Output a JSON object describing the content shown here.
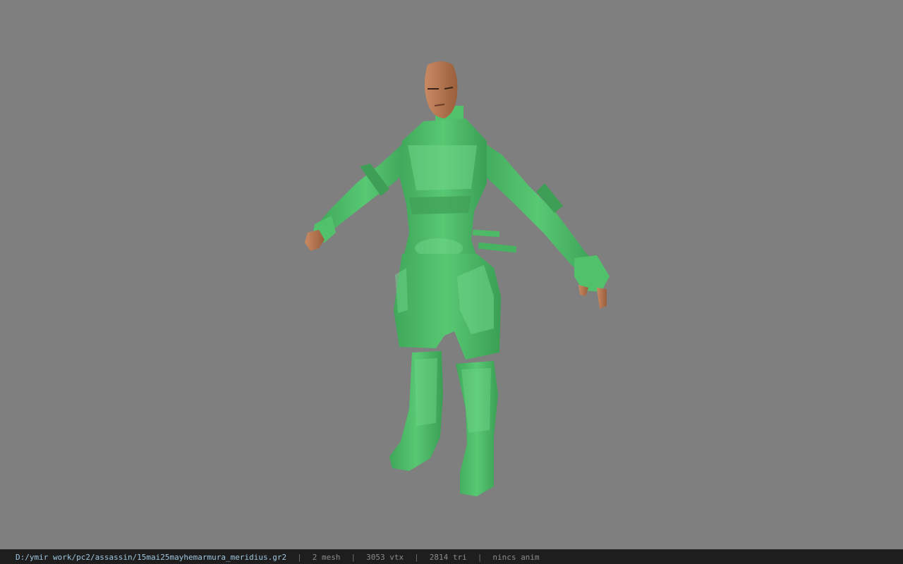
{
  "viewer": {
    "background_color": "#7f7f7f",
    "model_color": "#4dbe67",
    "skin_color": "#b5734f"
  },
  "statusbar": {
    "file_path": "D:/ymir work/pc2/assassin/15mai25mayhemarmura_meridius.gr2",
    "separator": "|",
    "mesh_count": "2 mesh",
    "vertex_count": "3053 vtx",
    "triangle_count": "2814 tri",
    "anim_status": "nincs anim"
  }
}
